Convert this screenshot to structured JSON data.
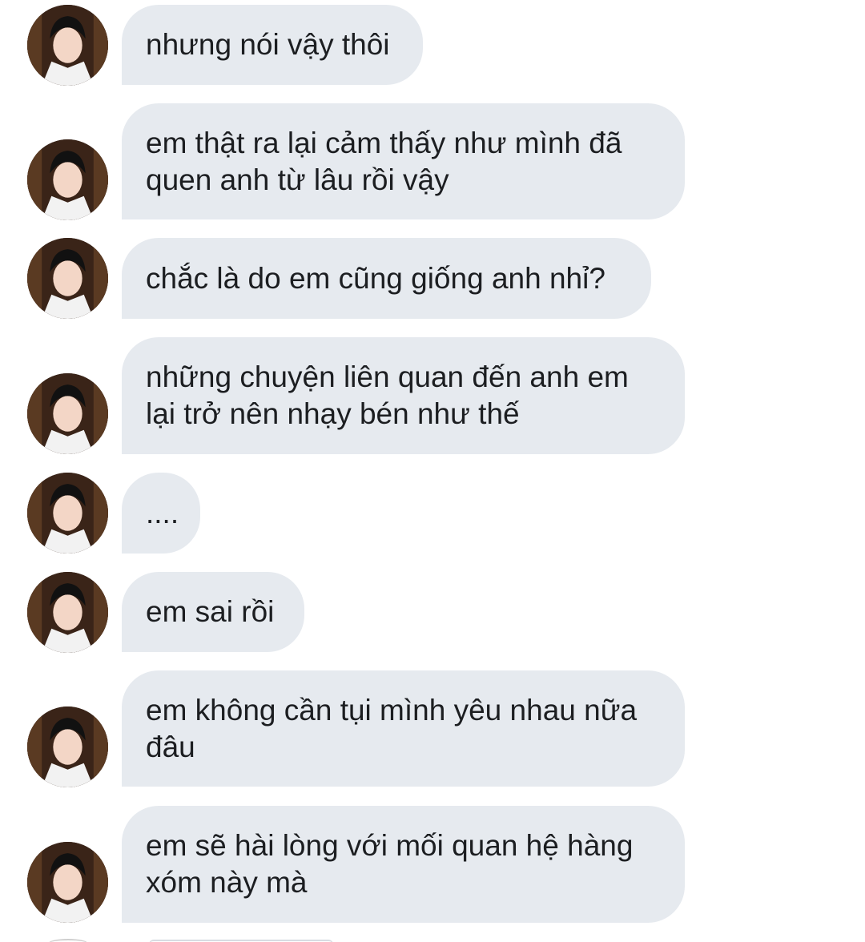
{
  "conversation": {
    "messages": [
      {
        "text": "nhưng nói vậy thôi"
      },
      {
        "text": "em thật ra lại cảm thấy như mình đã quen anh từ lâu rồi vậy"
      },
      {
        "text": "chắc là do em cũng giống anh nhỉ?"
      },
      {
        "text": "những chuyện liên quan đến anh em lại trở nên nhạy bén như thế"
      },
      {
        "text": "...."
      },
      {
        "text": "em sai rồi"
      },
      {
        "text": "em không cần tụi mình yêu nhau nữa đâu"
      },
      {
        "text": "em sẽ hài lòng với mối quan hệ hàng xóm này mà"
      }
    ]
  },
  "avatar_icon": "user-avatar-icon",
  "colors": {
    "bubble_background": "#e6eaef",
    "text": "#1c1e21",
    "page_background": "#ffffff"
  }
}
